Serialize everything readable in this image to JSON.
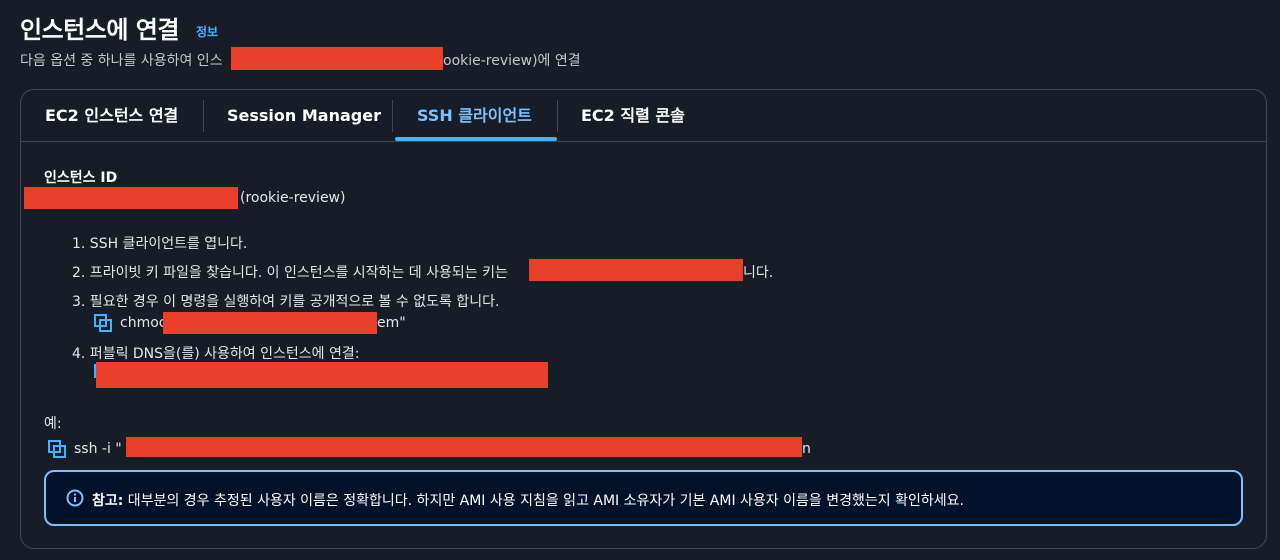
{
  "header": {
    "title": "인스턴스에 연결",
    "info_link": "정보",
    "subtitle_prefix": "다음 옵션 중 하나를 사용하여 인스",
    "subtitle_suffix": "ookie-review)에 연결"
  },
  "tabs": [
    {
      "label": "EC2 인스턴스 연결"
    },
    {
      "label": "Session Manager"
    },
    {
      "label": "SSH 클라이언트",
      "active": true
    },
    {
      "label": "EC2 직렬 콘솔"
    }
  ],
  "instance": {
    "label": "인스턴스 ID",
    "name_suffix": "(rookie-review)"
  },
  "steps": {
    "step1": "1. SSH 클라이언트를 엽니다.",
    "step2_prefix": "2. 프라이빗 키 파일을 찾습니다. 이 인스턴스를 시작하는 데 사용되는 키는",
    "step2_suffix": "니다.",
    "step3": "3. 필요한 경우 이 명령을 실행하여 키를 공개적으로 볼 수 없도록 합니다.",
    "step3_cmd_prefix": "chmoc",
    "step3_cmd_suffix": "em\"",
    "step4": "4. 퍼블릭 DNS을(를) 사용하여 인스턴스에 연결:"
  },
  "example": {
    "label": "예:",
    "cmd_prefix": "ssh -i \"",
    "cmd_suffix": "n"
  },
  "alert": {
    "label": "참고:",
    "text": " 대부분의 경우 추정된 사용자 이름은 정확합니다. 하지만 AMI 사용 지침을 읽고 AMI 소유자가 기본 AMI 사용자 이름을 변경했는지 확인하세요."
  },
  "colors": {
    "background": "#161d26",
    "accent": "#42b4ff",
    "redaction": "#e8402a",
    "alert_bg": "#001129"
  },
  "icons": {
    "copy": "copy-icon",
    "info": "info-circle-icon"
  }
}
